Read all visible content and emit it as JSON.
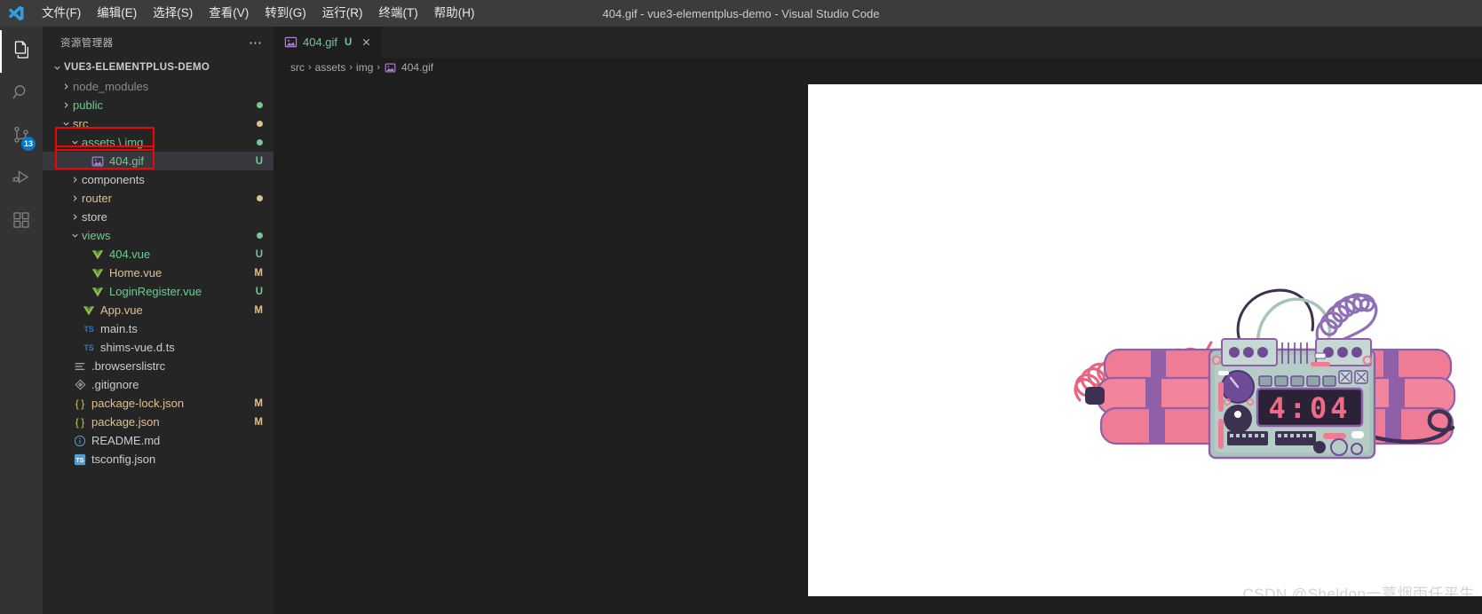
{
  "titlebar": {
    "logo_icon": "vscode-logo",
    "window_title": "404.gif - vue3-elementplus-demo - Visual Studio Code",
    "menu": [
      {
        "label": "文件(F)",
        "name": "menu-file"
      },
      {
        "label": "编辑(E)",
        "name": "menu-edit"
      },
      {
        "label": "选择(S)",
        "name": "menu-selection"
      },
      {
        "label": "查看(V)",
        "name": "menu-view"
      },
      {
        "label": "转到(G)",
        "name": "menu-go"
      },
      {
        "label": "运行(R)",
        "name": "menu-run"
      },
      {
        "label": "终端(T)",
        "name": "menu-terminal"
      },
      {
        "label": "帮助(H)",
        "name": "menu-help"
      }
    ]
  },
  "activitybar": {
    "items": [
      {
        "name": "activity-explorer",
        "icon": "files-icon",
        "active": true,
        "badge": ""
      },
      {
        "name": "activity-search",
        "icon": "search-icon",
        "active": false,
        "badge": ""
      },
      {
        "name": "activity-source-control",
        "icon": "source-control-icon",
        "active": false,
        "badge": "13"
      },
      {
        "name": "activity-run-debug",
        "icon": "run-and-debug-icon",
        "active": false,
        "badge": ""
      },
      {
        "name": "activity-extensions",
        "icon": "extensions-icon",
        "active": false,
        "badge": ""
      }
    ]
  },
  "sidebar": {
    "title": "资源管理器",
    "more_icon": "ellipsis-icon",
    "root_label": "VUE3-ELEMENTPLUS-DEMO",
    "tree": [
      {
        "name": "tree-item-node-modules",
        "label": "node_modules",
        "depth": 1,
        "type": "folder",
        "expanded": false,
        "icon": "chevron-right-icon",
        "color": "#8a8a8a",
        "status": "",
        "dot": ""
      },
      {
        "name": "tree-item-public",
        "label": "public",
        "depth": 1,
        "type": "folder",
        "expanded": false,
        "icon": "chevron-right-icon",
        "color": "#73c991",
        "status": "",
        "dot": "#73c991"
      },
      {
        "name": "tree-item-src",
        "label": "src",
        "depth": 1,
        "type": "folder",
        "expanded": true,
        "icon": "chevron-down-icon",
        "color": "#e2c08d",
        "status": "",
        "dot": "#e2c08d"
      },
      {
        "name": "tree-item-assets-img",
        "label": "assets \\ img",
        "depth": 2,
        "type": "folder",
        "expanded": true,
        "icon": "chevron-down-icon",
        "color": "#73c991",
        "status": "",
        "dot": "#73c991"
      },
      {
        "name": "tree-item-404-gif",
        "label": "404.gif",
        "depth": 3,
        "type": "image",
        "expanded": false,
        "icon": "image-file-icon",
        "color": "#73c991",
        "status": "U",
        "dot": "",
        "selected": true
      },
      {
        "name": "tree-item-components",
        "label": "components",
        "depth": 2,
        "type": "folder",
        "expanded": false,
        "icon": "chevron-right-icon",
        "color": "#cccccc",
        "status": "",
        "dot": ""
      },
      {
        "name": "tree-item-router",
        "label": "router",
        "depth": 2,
        "type": "folder",
        "expanded": false,
        "icon": "chevron-right-icon",
        "color": "#e2c08d",
        "status": "",
        "dot": "#e2c08d"
      },
      {
        "name": "tree-item-store",
        "label": "store",
        "depth": 2,
        "type": "folder",
        "expanded": false,
        "icon": "chevron-right-icon",
        "color": "#cccccc",
        "status": "",
        "dot": ""
      },
      {
        "name": "tree-item-views",
        "label": "views",
        "depth": 2,
        "type": "folder",
        "expanded": true,
        "icon": "chevron-down-icon",
        "color": "#73c991",
        "status": "",
        "dot": "#73c991"
      },
      {
        "name": "tree-item-404-vue",
        "label": "404.vue",
        "depth": 3,
        "type": "vue",
        "expanded": false,
        "icon": "vue-file-icon",
        "color": "#73c991",
        "status": "U",
        "dot": ""
      },
      {
        "name": "tree-item-home-vue",
        "label": "Home.vue",
        "depth": 3,
        "type": "vue",
        "expanded": false,
        "icon": "vue-file-icon",
        "color": "#e2c08d",
        "status": "M",
        "dot": ""
      },
      {
        "name": "tree-item-loginregister-vue",
        "label": "LoginRegister.vue",
        "depth": 3,
        "type": "vue",
        "expanded": false,
        "icon": "vue-file-icon",
        "color": "#73c991",
        "status": "U",
        "dot": ""
      },
      {
        "name": "tree-item-app-vue",
        "label": "App.vue",
        "depth": 2,
        "type": "vue",
        "expanded": false,
        "icon": "vue-file-icon",
        "color": "#e2c08d",
        "status": "M",
        "dot": ""
      },
      {
        "name": "tree-item-main-ts",
        "label": "main.ts",
        "depth": 2,
        "type": "ts",
        "expanded": false,
        "icon": "typescript-file-icon",
        "color": "#cccccc",
        "status": "",
        "dot": ""
      },
      {
        "name": "tree-item-shims-vue-d-ts",
        "label": "shims-vue.d.ts",
        "depth": 2,
        "type": "ts",
        "expanded": false,
        "icon": "typescript-file-icon",
        "color": "#cccccc",
        "status": "",
        "dot": ""
      },
      {
        "name": "tree-item-browserslistrc",
        "label": ".browserslistrc",
        "depth": 1,
        "type": "config",
        "expanded": false,
        "icon": "settings-file-icon",
        "color": "#cccccc",
        "status": "",
        "dot": ""
      },
      {
        "name": "tree-item-gitignore",
        "label": ".gitignore",
        "depth": 1,
        "type": "git",
        "expanded": false,
        "icon": "git-file-icon",
        "color": "#cccccc",
        "status": "",
        "dot": ""
      },
      {
        "name": "tree-item-package-lock-json",
        "label": "package-lock.json",
        "depth": 1,
        "type": "json",
        "expanded": false,
        "icon": "json-file-icon",
        "color": "#e2c08d",
        "status": "M",
        "dot": ""
      },
      {
        "name": "tree-item-package-json",
        "label": "package.json",
        "depth": 1,
        "type": "json",
        "expanded": false,
        "icon": "json-file-icon",
        "color": "#e2c08d",
        "status": "M",
        "dot": ""
      },
      {
        "name": "tree-item-readme-md",
        "label": "README.md",
        "depth": 1,
        "type": "md",
        "expanded": false,
        "icon": "markdown-file-icon",
        "color": "#cccccc",
        "status": "",
        "dot": ""
      },
      {
        "name": "tree-item-tsconfig-json",
        "label": "tsconfig.json",
        "depth": 1,
        "type": "tsconfig",
        "expanded": false,
        "icon": "tsconfig-file-icon",
        "color": "#cccccc",
        "status": "",
        "dot": ""
      }
    ],
    "annotation_color": "#f00505"
  },
  "editor": {
    "tab": {
      "icon": "image-file-icon",
      "label": "404.gif",
      "status": "U",
      "close_icon": "close-icon"
    },
    "breadcrumbs": [
      {
        "label": "src",
        "name": "breadcrumb-src",
        "icon": ""
      },
      {
        "label": "assets",
        "name": "breadcrumb-assets",
        "icon": ""
      },
      {
        "label": "img",
        "name": "breadcrumb-img",
        "icon": ""
      },
      {
        "label": "404.gif",
        "name": "breadcrumb-404-gif",
        "icon": "image-file-icon"
      }
    ],
    "breadcrumb_separator": "›",
    "image": {
      "alt": "404 dynamite bomb with digital timer",
      "timer_text": "4:04",
      "background": "#ffffff"
    }
  },
  "watermark": "CSDN @Sheldon一蓑烟雨任平生",
  "colors": {
    "accent": "#007acc",
    "titlebar_bg": "#3c3c3c",
    "sidebar_bg": "#252526",
    "editor_bg": "#1e1e1e",
    "activitybar_bg": "#333333",
    "git_untracked": "#73c991",
    "git_modified": "#e2c08d",
    "annotation": "#f00505"
  }
}
